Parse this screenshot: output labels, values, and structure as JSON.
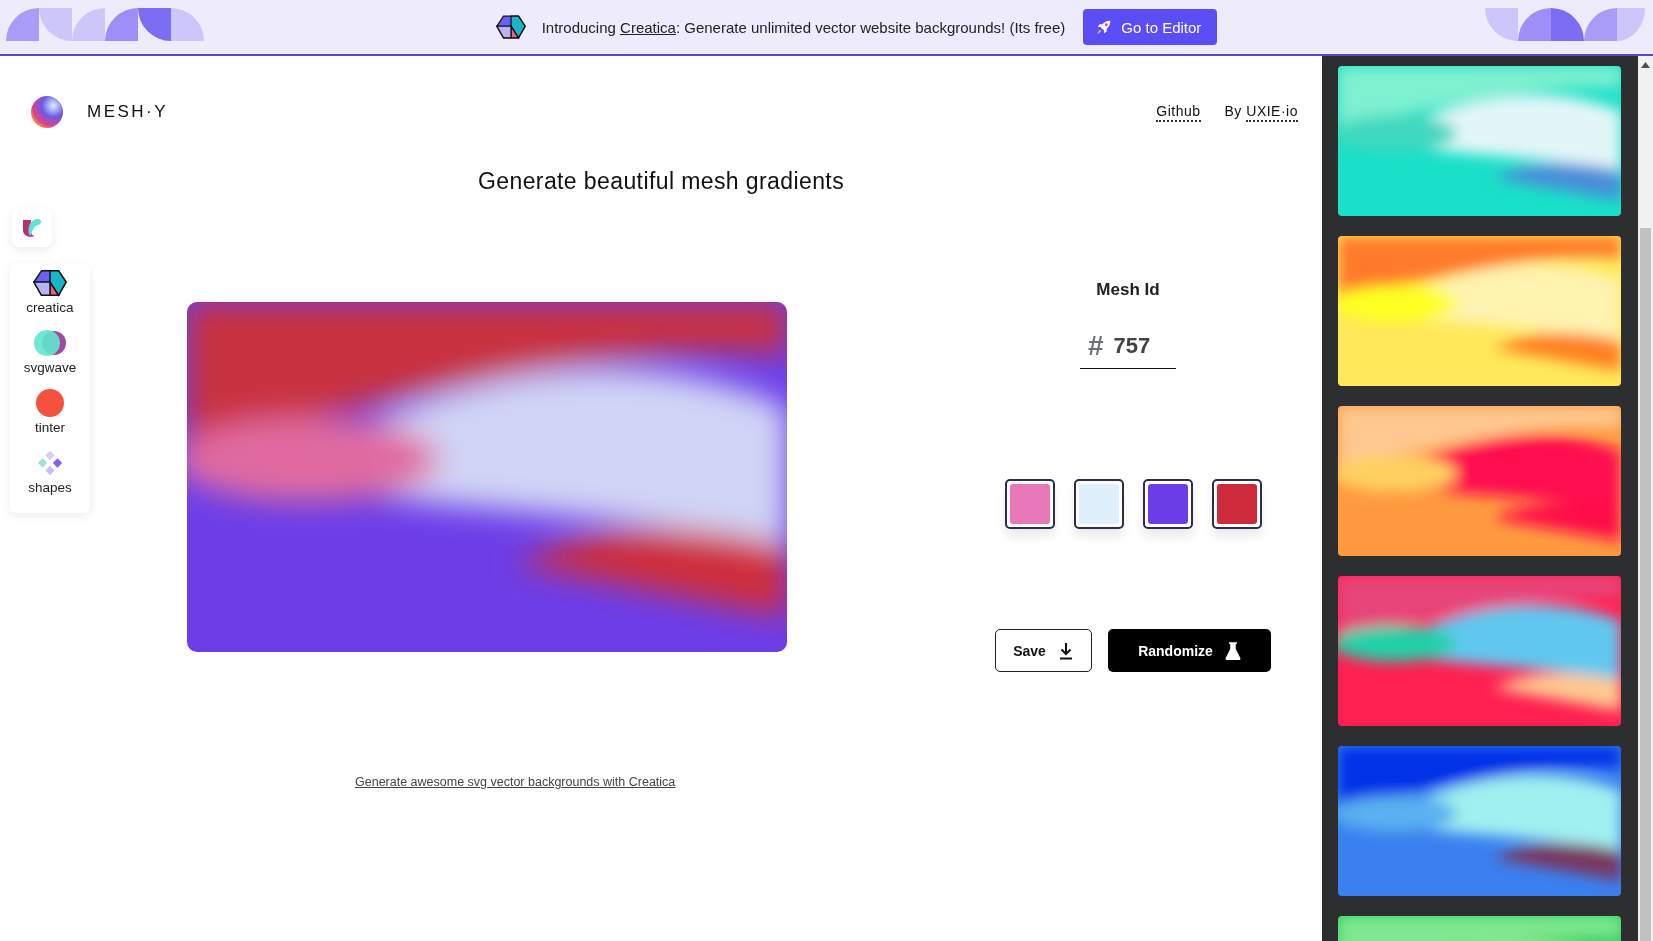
{
  "banner": {
    "prefix": "Introducing ",
    "link": "Creatica",
    "suffix": ": Generate unlimited vector website backgrounds! (Its free)",
    "button": "Go to Editor"
  },
  "header": {
    "logo": "MESH·Y",
    "github": "Github",
    "by_prefix": "By ",
    "by_link": "UXIE·io"
  },
  "title": "Generate beautiful mesh gradients",
  "sidebar": {
    "items": [
      {
        "label": "creatica",
        "kind": "cube"
      },
      {
        "label": "svgwave",
        "kind": "bubbles"
      },
      {
        "label": "tinter",
        "kind": "dot"
      },
      {
        "label": "shapes",
        "kind": "diamonds"
      }
    ]
  },
  "mesh_id": {
    "label": "Mesh Id",
    "prefix": "#",
    "value": "757"
  },
  "swatches": [
    {
      "color": "#e879b9"
    },
    {
      "color": "#dff0fc"
    },
    {
      "color": "#6b3de6"
    },
    {
      "color": "#cf2a3a"
    }
  ],
  "buttons": {
    "save": "Save",
    "randomize": "Randomize"
  },
  "footer_link": "Generate awesome svg vector backgrounds with Creatica"
}
